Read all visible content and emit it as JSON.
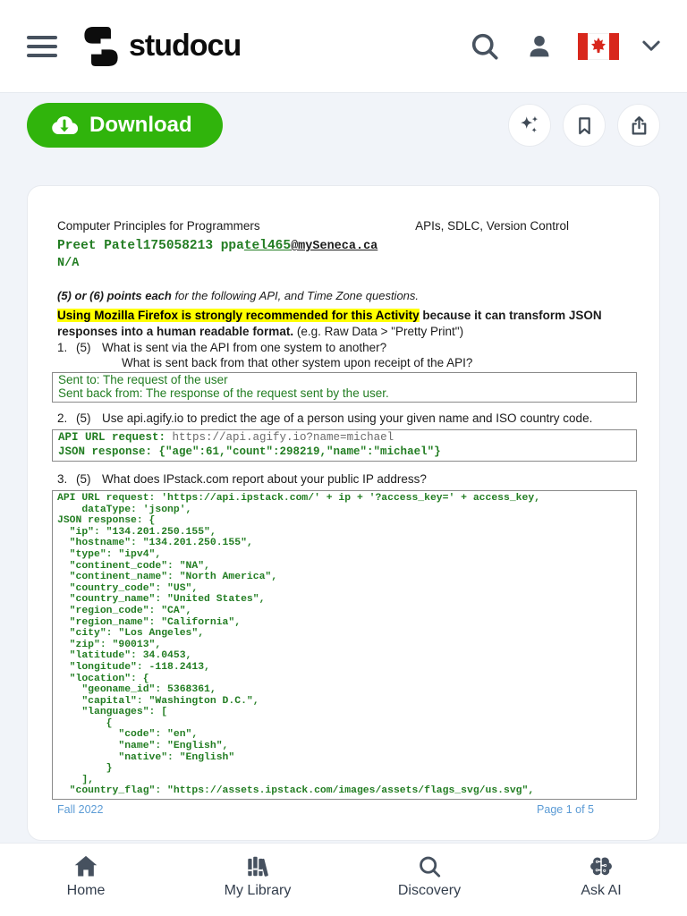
{
  "header": {
    "brand": "studocu"
  },
  "toolbar": {
    "download_label": "Download"
  },
  "icons": {
    "menu": "hamburger-menu-icon",
    "logo": "studocu-logo-icon",
    "search": "search-icon",
    "account": "person-icon",
    "language": "canada-flag-icon",
    "chevron": "chevron-down-icon",
    "download": "cloud-download-icon",
    "ai": "sparkles-icon",
    "bookmark": "bookmark-icon",
    "share": "share-icon",
    "home": "home-icon",
    "library": "books-icon",
    "discovery": "magnifier-icon",
    "ask_ai": "brain-circuit-icon"
  },
  "colors": {
    "accent_green": "#30b40c",
    "doc_green": "#227d22",
    "highlight_yellow": "#ffff00",
    "footer_blue": "#5b9bd5"
  },
  "document": {
    "header_left": "Computer Principles for Programmers",
    "header_right": "APIs, SDLC, Version Control",
    "author": {
      "name_id": "Preet Patel175058213",
      "email_prefix": " ppa",
      "email_underlined": "tel465",
      "email_domain": "@mySeneca.ca"
    },
    "na": "N/A",
    "points_note": {
      "bold": "(5) or (6) points each",
      "rest": " for the following API, and Time Zone questions."
    },
    "firefox_note": {
      "highlighted": "Using Mozilla Firefox is strongly recommended for this Activity",
      "bold_rest": " because it can transform JSON responses into a human readable format.",
      "normal": " (e.g. Raw Data > \"Pretty Print\")"
    },
    "questions": [
      {
        "number": "1.",
        "points": "(5)",
        "line1": "What is sent via the API from one system to another?",
        "line2": "What is sent back from that other system upon receipt of the API?"
      },
      {
        "number": "2.",
        "points": "(5)",
        "line1": "Use api.agify.io to predict the age of a person using your given name and ISO country code."
      },
      {
        "number": "3.",
        "points": "(5)",
        "line1": "What does IPstack.com report about your public IP address?"
      }
    ],
    "answer1": {
      "line1": "Sent to: The request of the user",
      "line2": "Sent back from: The response of the request sent by the user."
    },
    "answer2": {
      "label1": "API URL request: ",
      "value1": "https://api.agify.io?name=michael",
      "line2": "JSON response: {\"age\":61,\"count\":298219,\"name\":\"michael\"}"
    },
    "answer3_code": "API URL request: 'https://api.ipstack.com/' + ip + '?access_key=' + access_key,\n    dataType: 'jsonp',\nJSON response: {\n  \"ip\": \"134.201.250.155\",\n  \"hostname\": \"134.201.250.155\",\n  \"type\": \"ipv4\",\n  \"continent_code\": \"NA\",\n  \"continent_name\": \"North America\",\n  \"country_code\": \"US\",\n  \"country_name\": \"United States\",\n  \"region_code\": \"CA\",\n  \"region_name\": \"California\",\n  \"city\": \"Los Angeles\",\n  \"zip\": \"90013\",\n  \"latitude\": 34.0453,\n  \"longitude\": -118.2413,\n  \"location\": {\n    \"geoname_id\": 5368361,\n    \"capital\": \"Washington D.C.\",\n    \"languages\": [\n        {\n          \"code\": \"en\",\n          \"name\": \"English\",\n          \"native\": \"English\"\n        }\n    ],\n  \"country_flag\": \"https://assets.ipstack.com/images/assets/flags_svg/us.svg\",",
    "footer_left": "Fall 2022",
    "footer_right": "Page 1 of 5"
  },
  "bottom_nav": {
    "items": [
      {
        "label": "Home"
      },
      {
        "label": "My Library"
      },
      {
        "label": "Discovery"
      },
      {
        "label": "Ask AI"
      }
    ]
  }
}
